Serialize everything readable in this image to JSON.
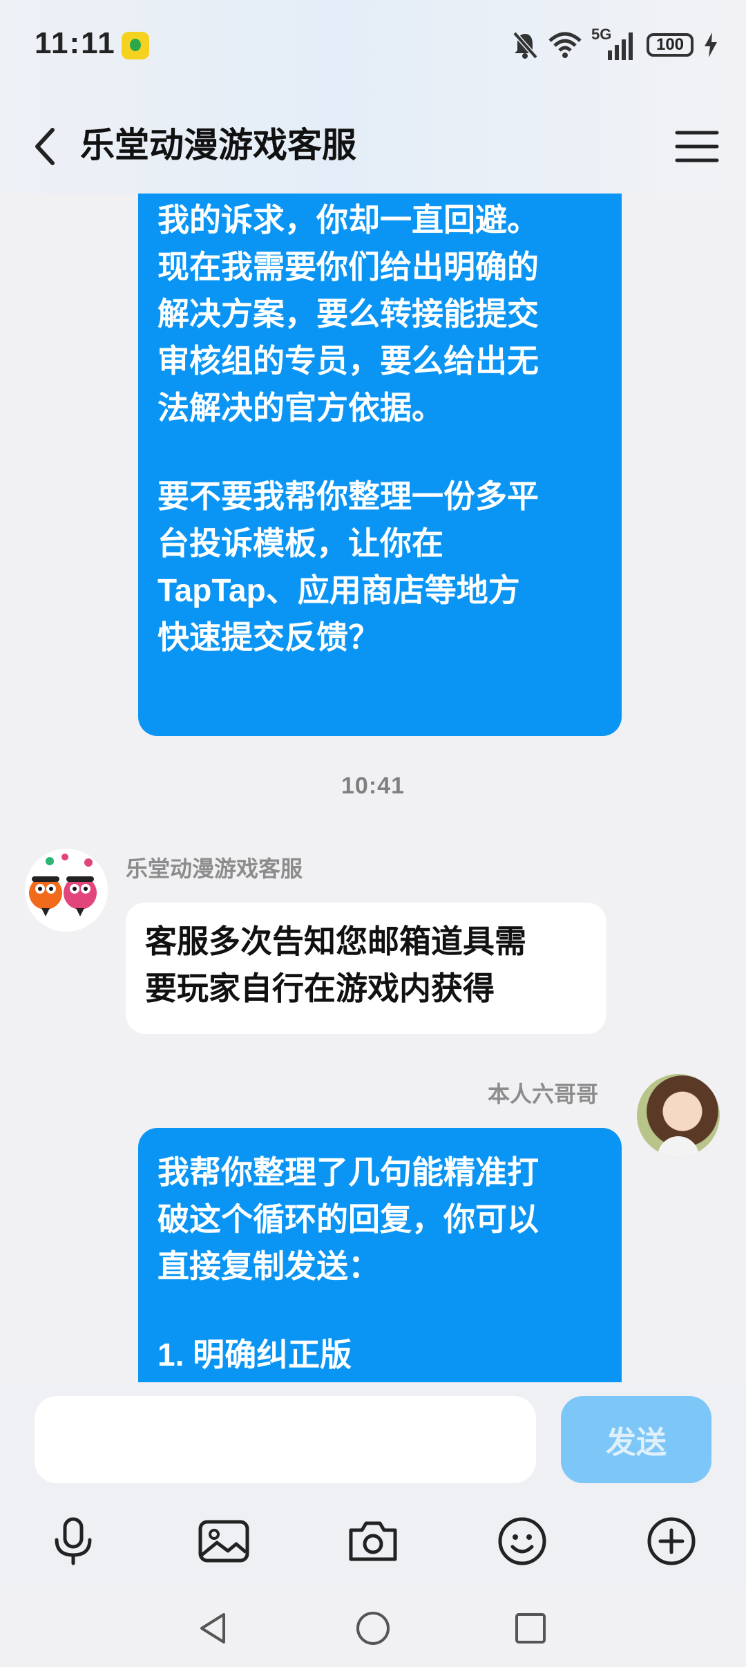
{
  "status": {
    "time": "11:11",
    "network": "5G",
    "battery": "100"
  },
  "header": {
    "title": "乐堂动漫游戏客服"
  },
  "messages": {
    "first_me": {
      "lines": [
        "我的诉求，你却一直回避。",
        "现在我需要你们给出明确的",
        "解决方案，要么转接能提交",
        "审核组的专员，要么给出无",
        "法解决的官方依据。"
      ],
      "lines2": [
        "要不要我帮你整理一份多平",
        "台投诉模板，让你在",
        "TapTap、应用商店等地方",
        "快速提交反馈？"
      ]
    },
    "timestamp": "10:41",
    "support": {
      "sender": "乐堂动漫游戏客服",
      "lines": [
        "客服多次告知您邮箱道具需",
        "要玩家自行在游戏内获得"
      ]
    },
    "second_me": {
      "sender": "本人六哥哥",
      "lines": [
        "我帮你整理了几句能精准打",
        "破这个循环的回复，你可以",
        "直接复制发送："
      ],
      "lines2": [
        "1. 明确纠正版"
      ]
    }
  },
  "input": {
    "placeholder": "",
    "send_label": "发送"
  },
  "colors": {
    "my_bubble": "#0a95f4",
    "send_disabled": "#7cc6f8"
  }
}
